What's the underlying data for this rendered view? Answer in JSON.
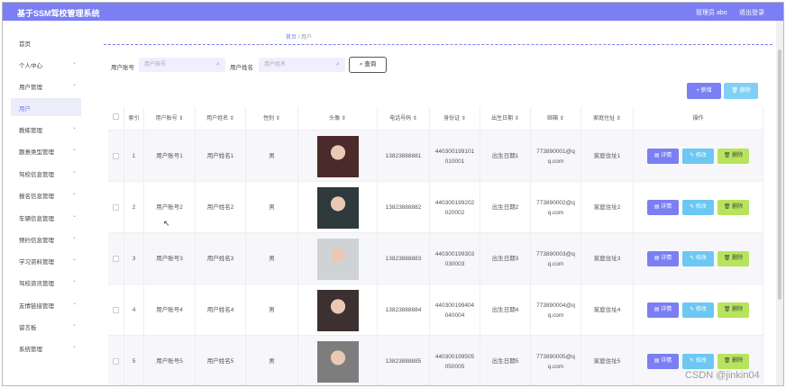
{
  "app": {
    "title": "基于SSM驾校管理系统",
    "user": "管理员 abo",
    "logout": "退出登录"
  },
  "sidebar": {
    "items": [
      {
        "label": "首页",
        "chevron": false,
        "active": false
      },
      {
        "label": "个人中心",
        "chevron": true,
        "active": false
      },
      {
        "label": "用户管理",
        "chevron": true,
        "active": false
      },
      {
        "label": "用户",
        "chevron": false,
        "active": true
      },
      {
        "label": "教练管理",
        "chevron": true,
        "active": false
      },
      {
        "label": "题意类型管理",
        "chevron": true,
        "active": false
      },
      {
        "label": "驾校信息管理",
        "chevron": true,
        "active": false
      },
      {
        "label": "报名信息管理",
        "chevron": true,
        "active": false
      },
      {
        "label": "车辆信息管理",
        "chevron": true,
        "active": false
      },
      {
        "label": "预约信息管理",
        "chevron": true,
        "active": false
      },
      {
        "label": "学习资料管理",
        "chevron": true,
        "active": false
      },
      {
        "label": "驾校资讯管理",
        "chevron": true,
        "active": false
      },
      {
        "label": "友情链接管理",
        "chevron": true,
        "active": false
      },
      {
        "label": "留言板",
        "chevron": true,
        "active": false
      },
      {
        "label": "系统管理",
        "chevron": true,
        "active": false
      }
    ]
  },
  "breadcrumb": {
    "home": "首页",
    "sep": "/",
    "current": "用户"
  },
  "search": {
    "account_label": "用户账号",
    "account_placeholder": "用户账号",
    "name_label": "用户姓名",
    "name_placeholder": "用户姓名",
    "query_label": "查询"
  },
  "actions": {
    "add": "+ 新增",
    "delete": "删除"
  },
  "table": {
    "headers": [
      "",
      "索引",
      "用户账号 ⇕",
      "用户姓名 ⇕",
      "性别 ⇕",
      "头像 ⇕",
      "电话号码 ⇕",
      "身份证 ⇕",
      "出生日期 ⇕",
      "邮箱 ⇕",
      "家庭住址 ⇕",
      "操作"
    ],
    "rows": [
      {
        "index": "1",
        "account": "用户账号1",
        "name": "用户姓名1",
        "gender": "男",
        "phone": "13823888881",
        "id_card": "440300199101010001",
        "birth": "出生日期1",
        "email": "773890001@qq.com",
        "address": "家庭住址1",
        "avatar_bg": "#4a2a2a"
      },
      {
        "index": "2",
        "account": "用户账号2",
        "name": "用户姓名2",
        "gender": "男",
        "phone": "13823888882",
        "id_card": "440300199202020002",
        "birth": "出生日期2",
        "email": "773890002@qq.com",
        "address": "家庭住址2",
        "avatar_bg": "#2f3a3c"
      },
      {
        "index": "3",
        "account": "用户账号3",
        "name": "用户姓名3",
        "gender": "男",
        "phone": "13823888883",
        "id_card": "440300199303030003",
        "birth": "出生日期3",
        "email": "773890003@qq.com",
        "address": "家庭住址3",
        "avatar_bg": "#cfd3d6"
      },
      {
        "index": "4",
        "account": "用户账号4",
        "name": "用户姓名4",
        "gender": "男",
        "phone": "13823888884",
        "id_card": "440300199404040004",
        "birth": "出生日期4",
        "email": "773890004@qq.com",
        "address": "家庭住址4",
        "avatar_bg": "#3d3030"
      },
      {
        "index": "5",
        "account": "用户账号5",
        "name": "用户姓名5",
        "gender": "男",
        "phone": "13823888885",
        "id_card": "440300199505050005",
        "birth": "出生日期5",
        "email": "773890005@qq.com",
        "address": "家庭住址5",
        "avatar_bg": "#7d7d7d"
      }
    ],
    "ops": {
      "detail": "详情",
      "edit": "修改",
      "delete": "删除"
    }
  },
  "watermark": "CSDN @jinkin04",
  "colors": {
    "accent": "#7b7ff3",
    "edit": "#6cc7f3",
    "delete": "#b7e45c"
  }
}
